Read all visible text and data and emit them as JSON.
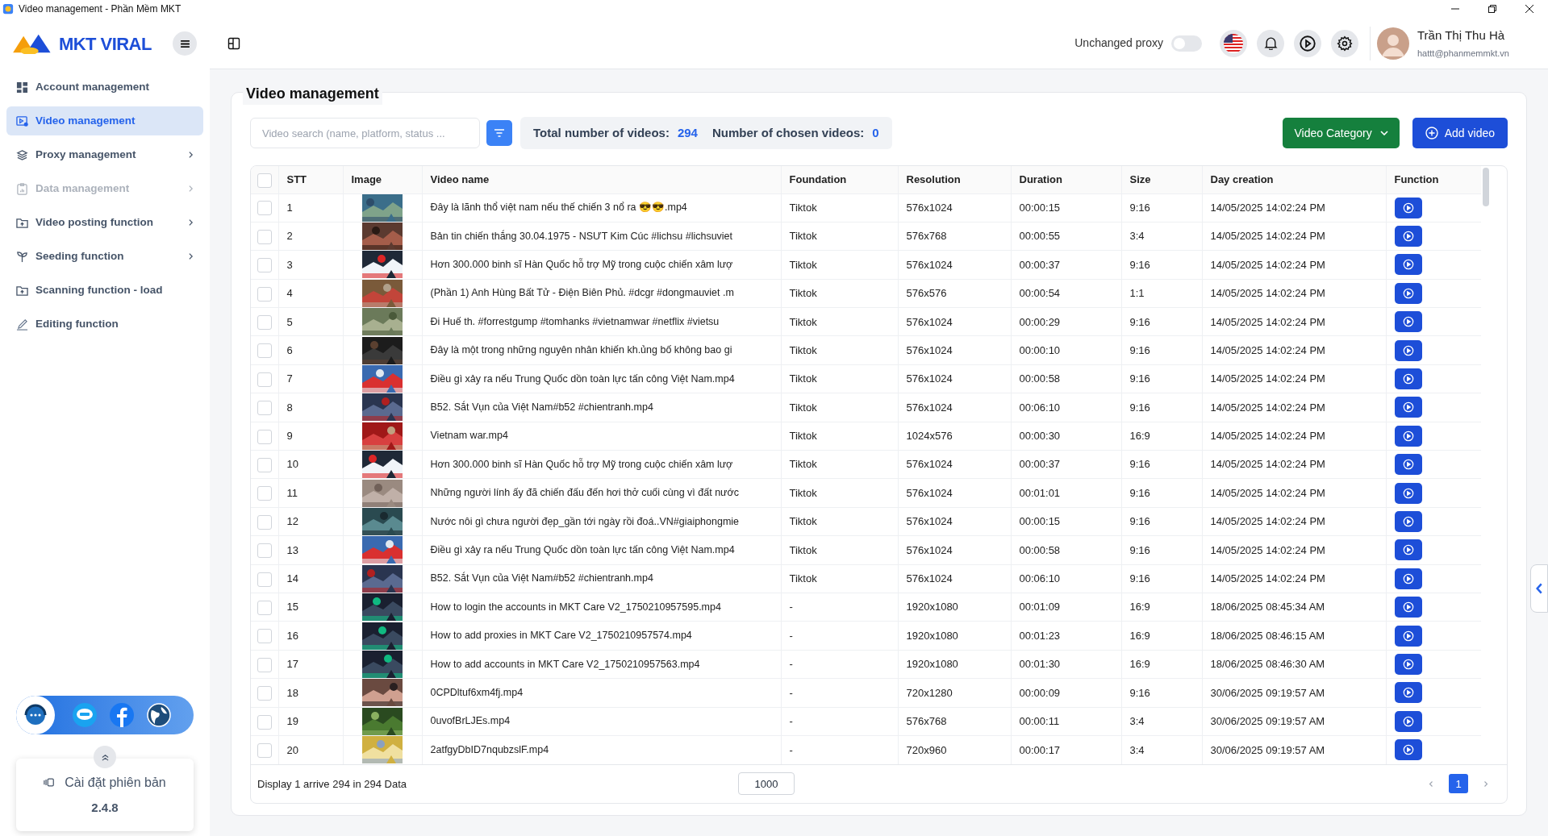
{
  "window": {
    "title": "Video management - Phần Mềm MKT"
  },
  "sidebar": {
    "logo": "MKT VIRAL",
    "items": [
      {
        "label": "Account management",
        "selected": false,
        "disabled": false,
        "expandable": false
      },
      {
        "label": "Video management",
        "selected": true,
        "disabled": false,
        "expandable": false
      },
      {
        "label": "Proxy management",
        "selected": false,
        "disabled": false,
        "expandable": true
      },
      {
        "label": "Data management",
        "selected": false,
        "disabled": true,
        "expandable": true
      },
      {
        "label": "Video posting function",
        "selected": false,
        "disabled": false,
        "expandable": true
      },
      {
        "label": "Seeding function",
        "selected": false,
        "disabled": false,
        "expandable": true
      },
      {
        "label": "Scanning function - load",
        "selected": false,
        "disabled": false,
        "expandable": false
      },
      {
        "label": "Editing function",
        "selected": false,
        "disabled": false,
        "expandable": false
      }
    ],
    "version_card": {
      "label": "Cài đặt phiên bản",
      "version": "2.4.8"
    }
  },
  "header": {
    "proxy_toggle": {
      "label": "Unchanged proxy",
      "on": false
    },
    "user": {
      "name": "Trần Thị Thu Hà",
      "email": "hattt@phanmemmkt.vn"
    }
  },
  "panel": {
    "title": "Video management",
    "search": {
      "placeholder": "Video search (name, platform, status ..."
    },
    "stats": [
      {
        "label": "Total number of videos:",
        "value": "294"
      },
      {
        "label": "Number of chosen videos:",
        "value": "0"
      }
    ],
    "buttons": [
      {
        "label": "Video Category",
        "kind": "dropdown"
      },
      {
        "label": "Add video",
        "kind": "add"
      }
    ]
  },
  "table": {
    "select_all": false,
    "columns": [
      "STT",
      "Image",
      "Video name",
      "Foundation",
      "Resolution",
      "Duration",
      "Size",
      "Day creation",
      "Function"
    ],
    "rows": [
      {
        "stt": "1",
        "name": "Đây là lãnh thổ việt nam nếu thế chiến 3 nổ ra 😎😎.mp4",
        "foundation": "Tiktok",
        "resolution": "576x1024",
        "duration": "00:00:15",
        "size": "9:16",
        "created": "14/05/2025 14:02:24 PM",
        "checked": false
      },
      {
        "stt": "2",
        "name": "Bản tin chiến thắng 30.04.1975 - NSƯT Kim Cúc #lichsu #lichsuviet",
        "foundation": "Tiktok",
        "resolution": "576x768",
        "duration": "00:00:55",
        "size": "3:4",
        "created": "14/05/2025 14:02:24 PM",
        "checked": false
      },
      {
        "stt": "3",
        "name": "Hơn 300.000 binh sĩ Hàn Quốc hỗ trợ Mỹ trong cuộc chiến xâm lượ",
        "foundation": "Tiktok",
        "resolution": "576x1024",
        "duration": "00:00:37",
        "size": "9:16",
        "created": "14/05/2025 14:02:24 PM",
        "checked": false
      },
      {
        "stt": "4",
        "name": "(Phần 1) Anh Hùng Bất Tử - Điện Biên Phủ. #dcgr #dongmauviet .m",
        "foundation": "Tiktok",
        "resolution": "576x576",
        "duration": "00:00:54",
        "size": "1:1",
        "created": "14/05/2025 14:02:24 PM",
        "checked": false
      },
      {
        "stt": "5",
        "name": "Đi Huế th. #forrestgump #tomhanks #vietnamwar #netflix #vietsu",
        "foundation": "Tiktok",
        "resolution": "576x1024",
        "duration": "00:00:29",
        "size": "9:16",
        "created": "14/05/2025 14:02:24 PM",
        "checked": false
      },
      {
        "stt": "6",
        "name": "Đây là một trong những nguyên nhân khiến kh.ủng bố không bao gi",
        "foundation": "Tiktok",
        "resolution": "576x1024",
        "duration": "00:00:10",
        "size": "9:16",
        "created": "14/05/2025 14:02:24 PM",
        "checked": false
      },
      {
        "stt": "7",
        "name": "Điều gì xảy ra nếu Trung Quốc dồn toàn lực tấn công Việt Nam.mp4",
        "foundation": "Tiktok",
        "resolution": "576x1024",
        "duration": "00:00:58",
        "size": "9:16",
        "created": "14/05/2025 14:02:24 PM",
        "checked": false
      },
      {
        "stt": "8",
        "name": "B52. Sắt Vụn của Việt Nam#b52 #chientranh.mp4",
        "foundation": "Tiktok",
        "resolution": "576x1024",
        "duration": "00:06:10",
        "size": "9:16",
        "created": "14/05/2025 14:02:24 PM",
        "checked": false
      },
      {
        "stt": "9",
        "name": "Vietnam war.mp4",
        "foundation": "Tiktok",
        "resolution": "1024x576",
        "duration": "00:00:30",
        "size": "16:9",
        "created": "14/05/2025 14:02:24 PM",
        "checked": false
      },
      {
        "stt": "10",
        "name": "Hơn 300.000 binh sĩ Hàn Quốc hỗ trợ Mỹ trong cuộc chiến xâm lượ",
        "foundation": "Tiktok",
        "resolution": "576x1024",
        "duration": "00:00:37",
        "size": "9:16",
        "created": "14/05/2025 14:02:24 PM",
        "checked": false
      },
      {
        "stt": "11",
        "name": "Những người lính ấy đã chiến đấu đến hơi thở cuối cùng vì đất nước",
        "foundation": "Tiktok",
        "resolution": "576x1024",
        "duration": "00:01:01",
        "size": "9:16",
        "created": "14/05/2025 14:02:24 PM",
        "checked": false
      },
      {
        "stt": "12",
        "name": "Nước nôi gì chưa người đẹp_gần tới ngày rồi đoá..VN#giaiphongmie",
        "foundation": "Tiktok",
        "resolution": "576x1024",
        "duration": "00:00:15",
        "size": "9:16",
        "created": "14/05/2025 14:02:24 PM",
        "checked": false
      },
      {
        "stt": "13",
        "name": "Điều gì xảy ra nếu Trung Quốc dồn toàn lực tấn công Việt Nam.mp4",
        "foundation": "Tiktok",
        "resolution": "576x1024",
        "duration": "00:00:58",
        "size": "9:16",
        "created": "14/05/2025 14:02:24 PM",
        "checked": false
      },
      {
        "stt": "14",
        "name": "B52. Sắt Vụn của Việt Nam#b52 #chientranh.mp4",
        "foundation": "Tiktok",
        "resolution": "576x1024",
        "duration": "00:06:10",
        "size": "9:16",
        "created": "14/05/2025 14:02:24 PM",
        "checked": false
      },
      {
        "stt": "15",
        "name": "How to login the accounts in MKT Care V2_1750210957595.mp4",
        "foundation": "-",
        "resolution": "1920x1080",
        "duration": "00:01:09",
        "size": "16:9",
        "created": "18/06/2025 08:45:34 AM",
        "checked": false
      },
      {
        "stt": "16",
        "name": "How to add proxies in MKT Care V2_1750210957574.mp4",
        "foundation": "-",
        "resolution": "1920x1080",
        "duration": "00:01:23",
        "size": "16:9",
        "created": "18/06/2025 08:46:15 AM",
        "checked": false
      },
      {
        "stt": "17",
        "name": "How to add accounts in MKT Care V2_1750210957563.mp4",
        "foundation": "-",
        "resolution": "1920x1080",
        "duration": "00:01:30",
        "size": "16:9",
        "created": "18/06/2025 08:46:30 AM",
        "checked": false
      },
      {
        "stt": "18",
        "name": "0CPDltuf6xm4fj.mp4",
        "foundation": "-",
        "resolution": "720x1280",
        "duration": "00:00:09",
        "size": "9:16",
        "created": "30/06/2025 09:19:57 AM",
        "checked": false
      },
      {
        "stt": "19",
        "name": "0uvofBrLJEs.mp4",
        "foundation": "-",
        "resolution": "576x768",
        "duration": "00:00:11",
        "size": "3:4",
        "created": "30/06/2025 09:19:57 AM",
        "checked": false
      },
      {
        "stt": "20",
        "name": "2atfgyDbID7nqubzslF.mp4",
        "foundation": "-",
        "resolution": "720x960",
        "duration": "00:00:17",
        "size": "3:4",
        "created": "30/06/2025 09:19:57 AM",
        "checked": false
      }
    ]
  },
  "footer": {
    "summary": "Display 1 arrive 294 in 294 Data",
    "page_size": "1000",
    "pages": [
      {
        "label": "1",
        "selected": true
      }
    ]
  }
}
